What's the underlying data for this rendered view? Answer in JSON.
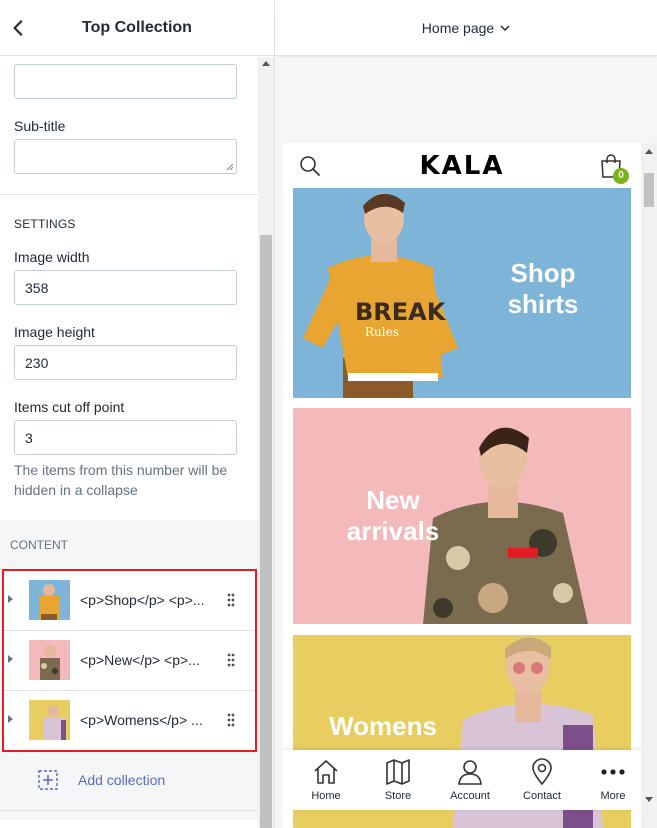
{
  "left_panel": {
    "title": "Top Collection",
    "fields": {
      "title_value": "",
      "subtitle_label": "Sub-title",
      "subtitle_value": "",
      "settings_heading": "SETTINGS",
      "image_width_label": "Image width",
      "image_width_value": "358",
      "image_height_label": "Image height",
      "image_height_value": "230",
      "cutoff_label": "Items cut off point",
      "cutoff_value": "3",
      "cutoff_help": "The items from this number will be hidden in a collapse"
    },
    "content_heading": "CONTENT",
    "items": [
      {
        "label": "<p>Shop</p> <p>...",
        "thumb_color": "#7db4d8"
      },
      {
        "label": "<p>New</p> <p>...",
        "thumb_color": "#f3b9bb"
      },
      {
        "label": "<p>Womens</p> ...",
        "thumb_color": "#e8cd60"
      }
    ],
    "add_label": "Add collection"
  },
  "right_panel": {
    "page_selector": "Home page",
    "preview": {
      "logo": "KALA",
      "cart_count": "0",
      "banners": [
        {
          "line1": "Shop",
          "line2": "shirts",
          "bg": "#7db4d8"
        },
        {
          "line1": "New",
          "line2": "arrivals",
          "bg": "#f3b9bb"
        },
        {
          "line1": "Womens",
          "line2": "",
          "bg": "#e8cd60"
        }
      ],
      "nav": [
        "Home",
        "Store",
        "Account",
        "Contact",
        "More"
      ]
    }
  },
  "colors": {
    "accent": "#5c6ac4",
    "highlight": "#e31b23",
    "badge": "#7ab317"
  }
}
